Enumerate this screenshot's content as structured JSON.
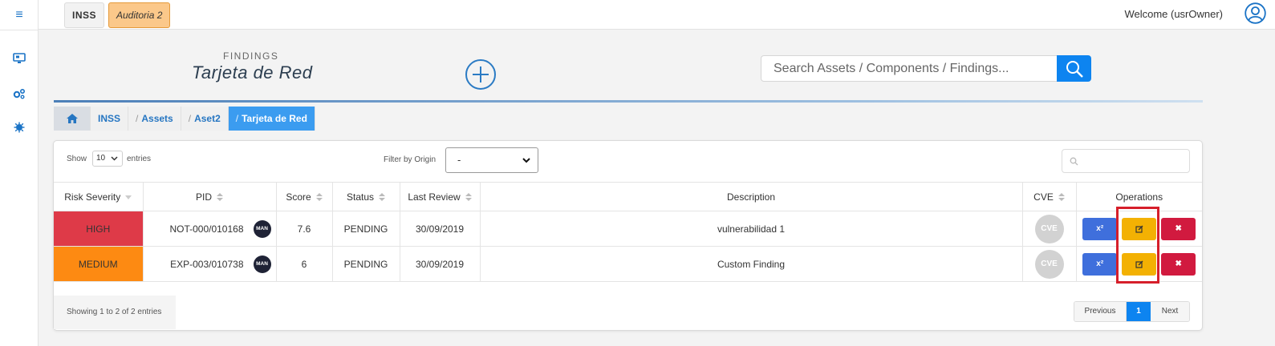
{
  "topbar": {
    "project_chip": "INSS",
    "audit_chip": "Auditoria 2",
    "welcome_text": "Welcome (usrOwner)"
  },
  "sidebar": {
    "items": [
      {
        "icon": "hamburger-menu-icon"
      },
      {
        "icon": "monitor-icon"
      },
      {
        "icon": "gears-icon"
      },
      {
        "icon": "virus-icon"
      }
    ]
  },
  "header": {
    "subtitle": "FINDINGS",
    "title": "Tarjeta de Red"
  },
  "search": {
    "placeholder": "Search Assets / Components / Findings..."
  },
  "breadcrumb": [
    {
      "label": "INSS"
    },
    {
      "label": "Assets"
    },
    {
      "label": "Aset2"
    },
    {
      "label": "Tarjeta de Red"
    }
  ],
  "breadcrumb_sep": "/",
  "table_controls": {
    "show_label": "Show",
    "page_size": "10",
    "entries_label": "entries",
    "filter_label": "Filter by Origin",
    "filter_value": "-"
  },
  "table": {
    "columns": [
      "Risk Severity",
      "PID",
      "Score",
      "Status",
      "Last Review",
      "Description",
      "CVE",
      "Operations"
    ],
    "rows": [
      {
        "severity": "HIGH",
        "pid": "NOT-000/010168",
        "badge": "MAN",
        "score": "7.6",
        "status": "PENDING",
        "last_review": "30/09/2019",
        "description": "vulnerabilidad 1",
        "cve": "CVE"
      },
      {
        "severity": "MEDIUM",
        "pid": "EXP-003/010738",
        "badge": "MAN",
        "score": "6",
        "status": "PENDING",
        "last_review": "30/09/2019",
        "description": "Custom Finding",
        "cve": "CVE"
      }
    ],
    "ops_labels": {
      "x2": "x²",
      "delete": "✖"
    }
  },
  "footer": {
    "info": "Showing 1 to 2 of 2 entries",
    "prev": "Previous",
    "page": "1",
    "next": "Next"
  },
  "colors": {
    "high": "#de3a48",
    "medium": "#fd8a12",
    "primary": "#0d84f0",
    "edit": "#f3b103",
    "delete": "#d11a3f",
    "x2": "#3f6fdc",
    "highlight": "#d61f2a"
  }
}
